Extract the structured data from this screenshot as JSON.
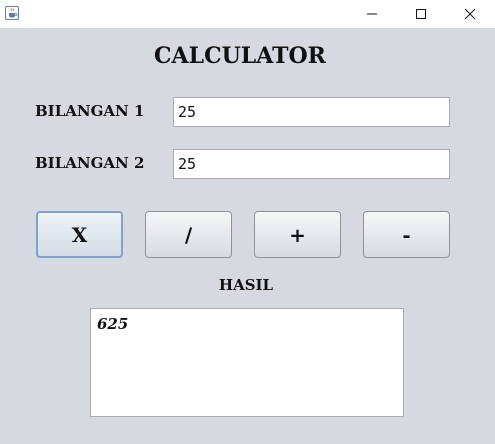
{
  "window": {
    "app_icon": "java-cup-icon",
    "controls": {
      "minimize_icon": "minimize-icon",
      "maximize_icon": "maximize-icon",
      "close_icon": "close-icon"
    }
  },
  "calculator": {
    "title": "CALCULATOR",
    "field1": {
      "label": "BILANGAN 1",
      "value": "25"
    },
    "field2": {
      "label": "BILANGAN 2",
      "value": "25"
    },
    "buttons": [
      {
        "id": "multiply",
        "label": "X"
      },
      {
        "id": "divide",
        "label": "/"
      },
      {
        "id": "add",
        "label": "+"
      },
      {
        "id": "subtract",
        "label": "-"
      }
    ],
    "result_label": "HASIL",
    "result_value": "625"
  },
  "colors": {
    "background": "#d6d9df",
    "focus_border": "#7da2ce"
  }
}
